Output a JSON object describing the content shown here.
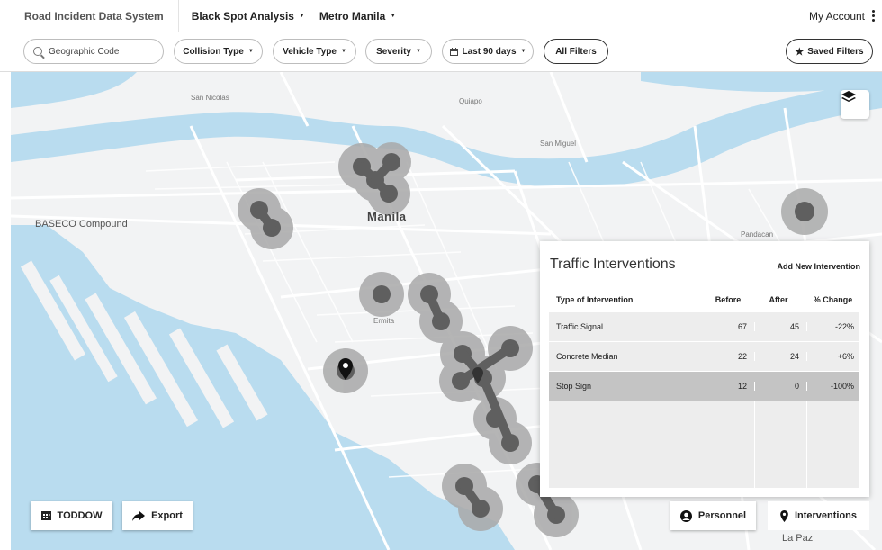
{
  "header": {
    "app_title": "Road Incident Data System",
    "menus": [
      {
        "label": "Black Spot Analysis"
      },
      {
        "label": "Metro Manila"
      }
    ],
    "account_label": "My Account"
  },
  "filters": {
    "search_placeholder": "Geographic Code",
    "collision_type": "Collision Type",
    "vehicle_type": "Vehicle Type",
    "severity": "Severity",
    "date_range": "Last 90 days",
    "all_filters": "All Filters",
    "saved_filters": "Saved Filters"
  },
  "map": {
    "labels": {
      "san_nicolas": "San Nicolas",
      "quiapo": "Quiapo",
      "san_miguel": "San Miguel",
      "baseco": "BASECO Compound",
      "manila": "Manila",
      "pandacan": "Pandacan",
      "ermita": "Ermita",
      "la_paz": "La Paz"
    },
    "colors": {
      "water": "#b9dcef",
      "land": "#f2f3f4",
      "road": "#ffffff",
      "hotspot_halo": "#a9a9a9",
      "hotspot_core": "#5f5f5f"
    }
  },
  "panel": {
    "title": "Traffic Interventions",
    "add_label": "Add New Intervention",
    "columns": [
      "Type of Intervention",
      "Before",
      "After",
      "% Change"
    ],
    "rows": [
      {
        "type": "Traffic Signal",
        "before": "67",
        "after": "45",
        "change": "-22%"
      },
      {
        "type": "Concrete Median",
        "before": "22",
        "after": "24",
        "change": "+6%"
      },
      {
        "type": "Stop Sign",
        "before": "12",
        "after": "0",
        "change": "-100%"
      }
    ]
  },
  "buttons": {
    "toddow": "TODDOW",
    "export": "Export",
    "personnel": "Personnel",
    "interventions": "Interventions"
  },
  "icons": [
    "search-icon",
    "chevron-down-icon",
    "more-vert-icon",
    "calendar-icon",
    "star-icon",
    "layers-icon",
    "map-pin-icon",
    "calendar-grid-icon",
    "share-arrow-icon",
    "person-icon",
    "location-pin-icon"
  ]
}
